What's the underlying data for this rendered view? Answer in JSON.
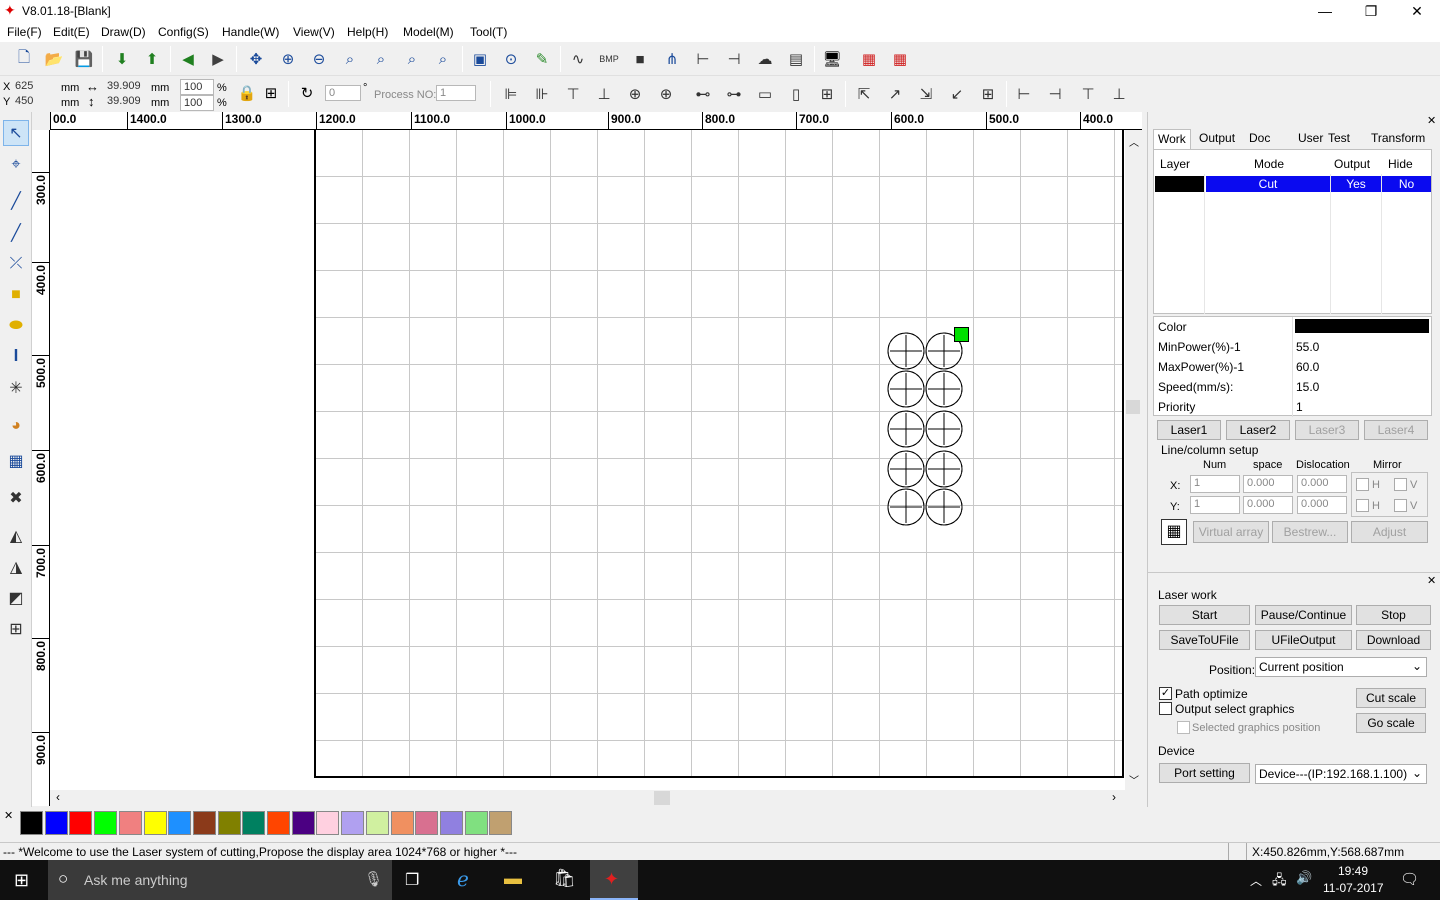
{
  "window": {
    "title": "V8.01.18-[Blank]"
  },
  "menu": [
    "File(F)",
    "Edit(E)",
    "Draw(D)",
    "Config(S)",
    "Handle(W)",
    "View(V)",
    "Help(H)",
    "Model(M)",
    "Tool(T)"
  ],
  "coords": {
    "x_label": "X",
    "x_value": "625",
    "y_label": "Y",
    "y_value": "450",
    "unit": "mm",
    "w_value": "39.909",
    "h_value": "39.909",
    "w_pct": "100",
    "h_pct": "100",
    "pct_unit": "%",
    "angle": "0",
    "degree": "°",
    "process_label": "Process NO:",
    "process_value": "1"
  },
  "ruler": {
    "h": [
      "00.0",
      "1400.0",
      "1300.0",
      "1200.0",
      "1100.0",
      "1000.0",
      "900.0",
      "800.0",
      "700.0",
      "600.0",
      "500.0",
      "400.0"
    ],
    "v": [
      "300.0",
      "400.0",
      "500.0",
      "600.0",
      "700.0",
      "800.0",
      "900.0"
    ]
  },
  "right_panel": {
    "tabs": [
      "Work",
      "Output",
      "Doc",
      "User",
      "Test",
      "Transform"
    ],
    "layer_headers": {
      "layer": "Layer",
      "mode": "Mode",
      "output": "Output",
      "hide": "Hide"
    },
    "layer_row": {
      "mode": "Cut",
      "output": "Yes",
      "hide": "No",
      "color": "#000000"
    },
    "props": [
      {
        "label": "Color",
        "value": ""
      },
      {
        "label": "MinPower(%)-1",
        "value": "55.0"
      },
      {
        "label": "MaxPower(%)-1",
        "value": "60.0"
      },
      {
        "label": "Speed(mm/s):",
        "value": "15.0"
      },
      {
        "label": "Priority",
        "value": "1"
      }
    ],
    "laser_tabs": [
      "Laser1",
      "Laser2",
      "Laser3",
      "Laser4"
    ],
    "line_column": {
      "title": "Line/column setup",
      "headers": {
        "num": "Num",
        "space": "space",
        "dislocation": "Dislocation",
        "mirror": "Mirror"
      },
      "x_label": "X:",
      "y_label": "Y:",
      "x_num": "1",
      "x_space": "0.000",
      "x_disl": "0.000",
      "y_num": "1",
      "y_space": "0.000",
      "y_disl": "0.000",
      "h": "H",
      "v": "V"
    },
    "buttons": {
      "virtual_array": "Virtual array",
      "bestrew": "Bestrew...",
      "adjust": "Adjust"
    }
  },
  "laser_work": {
    "title": "Laser work",
    "start": "Start",
    "pause": "Pause/Continue",
    "stop": "Stop",
    "save": "SaveToUFile",
    "ufile": "UFileOutput",
    "download": "Download",
    "position_label": "Position:",
    "position_value": "Current position",
    "path_optimize": "Path optimize",
    "output_select": "Output select graphics",
    "selected_position": "Selected graphics position",
    "cut_scale": "Cut scale",
    "go_scale": "Go scale",
    "device_label": "Device",
    "port_setting": "Port setting",
    "device_value": "Device---(IP:192.168.1.100)"
  },
  "palette": [
    "#000000",
    "#0000ff",
    "#ff0000",
    "#00ff00",
    "#f08080",
    "#ffff00",
    "#1e90ff",
    "#8b3a1a",
    "#808000",
    "#008060",
    "#ff4500",
    "#4b0082",
    "#ffd0e0",
    "#b0a0f0",
    "#d0f0a0",
    "#f09060",
    "#d87090",
    "#9080e0",
    "#80e080",
    "#c0a070"
  ],
  "status": {
    "message": "--- *Welcome to use the Laser system of cutting,Propose the display area 1024*768 or higher *---",
    "coords": "X:450.826mm,Y:568.687mm"
  },
  "taskbar": {
    "search": "Ask me anything",
    "time": "19:49",
    "date": "11-07-2017"
  }
}
